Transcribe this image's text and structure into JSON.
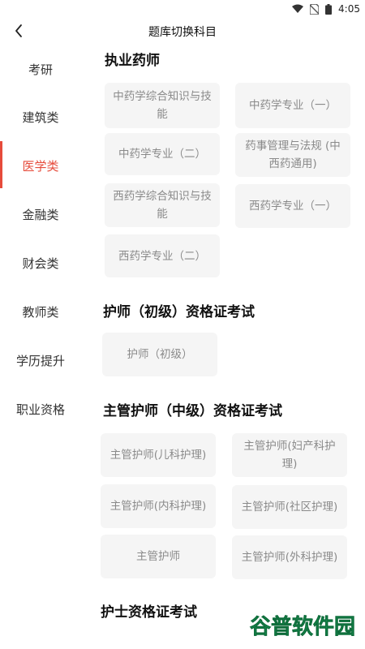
{
  "status": {
    "time": "4:05",
    "icons": [
      "wifi-icon",
      "no-sim-icon",
      "battery-icon"
    ]
  },
  "appbar": {
    "title": "题库切换科目",
    "back_icon": "chevron-left-icon"
  },
  "sidebar": {
    "active_index": 2,
    "items": [
      {
        "label": "考研"
      },
      {
        "label": "建筑类"
      },
      {
        "label": "医学类"
      },
      {
        "label": "金融类"
      },
      {
        "label": "财会类"
      },
      {
        "label": "教师类"
      },
      {
        "label": "学历提升"
      },
      {
        "label": "职业资格"
      }
    ]
  },
  "sections": [
    {
      "title": "执业药师",
      "items": [
        "中药学综合知识与技能",
        "中药学专业（一）",
        "中药学专业（二）",
        "药事管理与法规 (中西药通用)",
        "西药学综合知识与技能",
        "西药学专业（一）",
        "西药学专业（二）"
      ]
    },
    {
      "title": "护师（初级）资格证考试",
      "items": [
        "护师（初级）"
      ]
    },
    {
      "title": "主管护师（中级）资格证考试",
      "items": [
        "主管护师(儿科护理)",
        "主管护师(妇产科护理)",
        "主管护师(内科护理)",
        "主管护师(社区护理)",
        "主管护师",
        "主管护师(外科护理)"
      ]
    },
    {
      "title": "护士资格证考试",
      "items": []
    }
  ],
  "colors": {
    "accent": "#e64b3b",
    "chip_bg": "#f5f5f5",
    "chip_text": "#8a8a8a"
  },
  "watermark": {
    "text": "谷普软件园"
  }
}
